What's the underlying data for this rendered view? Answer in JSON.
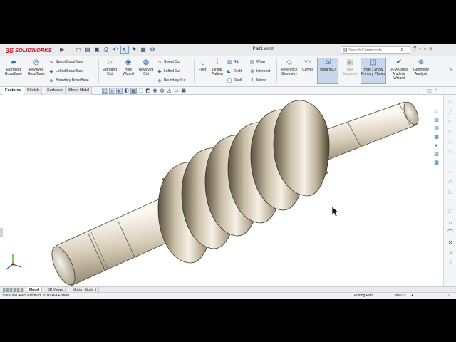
{
  "app": {
    "logo_text": "SOLIDWORKS",
    "logo_mark": "3S",
    "document_title": "Part1 worm",
    "search_placeholder": "Search Commands",
    "window_buttons": [
      "?",
      "-",
      "▫",
      "×"
    ]
  },
  "quick_access": [
    "new-icon",
    "open-icon",
    "save-icon",
    "print-icon",
    "undo-icon",
    "select-icon",
    "rebuild-icon",
    "options-icon"
  ],
  "command_manager": {
    "features": {
      "extruded_boss": "Extruded Boss/Base",
      "revolved_boss": "Revolved Boss/Base",
      "swept_boss": "Swept Boss/Base",
      "lofted_boss": "Lofted Boss/Base",
      "boundary_boss": "Boundary Boss/Base",
      "extruded_cut": "Extruded Cut",
      "hole_wizard": "Hole Wizard",
      "revolved_cut": "Revolved Cut",
      "swept_cut": "Swept Cut",
      "lofted_cut": "Lofted Cut",
      "boundary_cut": "Boundary Cut",
      "fillet": "Fillet",
      "linear_pattern": "Linear Pattern",
      "rib": "Rib",
      "draft": "Draft",
      "shell": "Shell",
      "wrap": "Wrap",
      "intersect": "Intersect",
      "mirror": "Mirror",
      "reference_geometry": "Reference Geometry",
      "curves": "Curves",
      "instant3d": "Instant3D",
      "take_snapshot": "Take Snapshot",
      "hide_show_planes": "Hide / Show Primary Planes",
      "dfmxpress": "DFMXpress Analysis Wizard",
      "geometry_analysis": "Geometry Analysis"
    },
    "tabs": [
      "Features",
      "Sketch",
      "Surfaces",
      "Sheet Metal"
    ],
    "active_tab": "Features"
  },
  "bottom_tabs": [
    "Model",
    "3D Views",
    "Motion Study 1"
  ],
  "active_bottom_tab": "Model",
  "status": {
    "edition": "SOLIDWORKS Premium 2016 x64 Edition",
    "mode": "Editing Part",
    "units": "MMGS",
    "units_arrow": "▲",
    "help": "?"
  },
  "colors": {
    "accent": "#2f6bb5",
    "logo_red": "#c8102e",
    "model_metal": "#cbbfa8"
  }
}
